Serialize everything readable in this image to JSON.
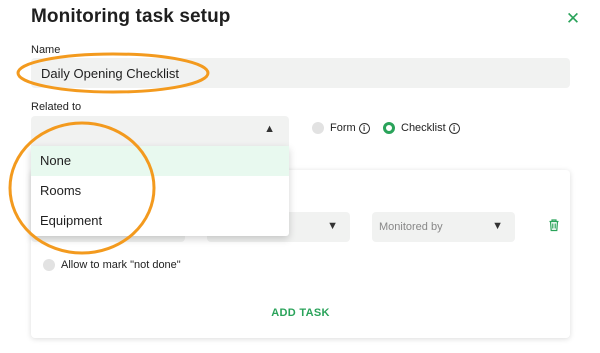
{
  "dialog": {
    "title": "Monitoring task setup",
    "close_icon": "close-icon"
  },
  "name_field": {
    "label": "Name",
    "value": "Daily Opening Checklist"
  },
  "related_to": {
    "label": "Related to",
    "value": "",
    "options": [
      "None",
      "Rooms",
      "Equipment"
    ],
    "highlighted_option": "None"
  },
  "type_radios": {
    "form_label": "Form",
    "checklist_label": "Checklist",
    "selected": "Checklist"
  },
  "task": {
    "monitored_by_placeholder": "Monitored by",
    "allow_not_done_label": "Allow to mark \"not done\"",
    "add_task_label": "ADD TASK"
  },
  "colors": {
    "accent": "#2aa35a",
    "annotation": "#f39a1e",
    "field_bg": "#f1f2f1",
    "highlight_bg": "#e8f9ef"
  }
}
